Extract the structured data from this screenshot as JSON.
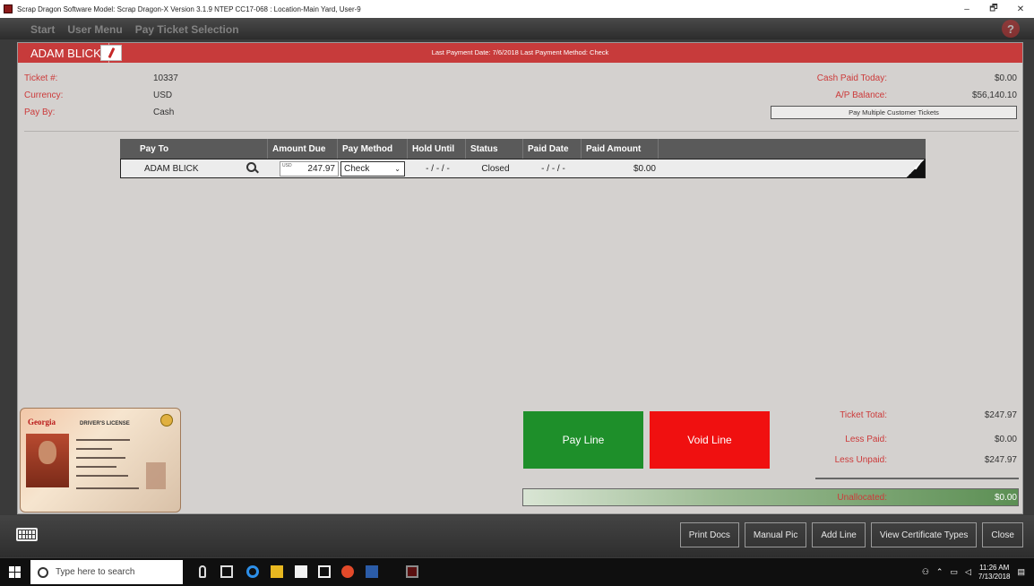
{
  "window": {
    "title": "Scrap Dragon Software Model: Scrap Dragon-X Version 3.1.9 NTEP CC17-068 : Location-Main Yard, User-9",
    "minimize": "–",
    "maximize": "🗗",
    "close": "✕"
  },
  "nav": {
    "start": "Start",
    "user_menu": "User Menu",
    "pay_ticket": "Pay Ticket Selection",
    "help": "?"
  },
  "customer": {
    "name": "ADAM BLICK",
    "payment_info": "Last Payment Date: 7/6/2018   Last Payment Method: Check"
  },
  "ticket": {
    "number_label": "Ticket #:",
    "number": "10337",
    "currency_label": "Currency:",
    "currency": "USD",
    "pay_by_label": "Pay By:",
    "pay_by": "Cash"
  },
  "summary": {
    "cash_paid_label": "Cash Paid Today:",
    "cash_paid": "$0.00",
    "ap_balance_label": "A/P Balance:",
    "ap_balance": "$56,140.10",
    "multi_button": "Pay Multiple Customer Tickets"
  },
  "grid": {
    "headers": [
      "Pay To",
      "Amount Due",
      "Pay Method",
      "Hold Until",
      "Status",
      "Paid Date",
      "Paid Amount"
    ],
    "row": {
      "pay_to": "ADAM BLICK",
      "currency": "USD",
      "amount_due": "247.97",
      "pay_method": "Check",
      "hold_until": "- / - / -",
      "status": "Closed",
      "paid_date": "- / - / -",
      "paid_amount": "$0.00"
    }
  },
  "id_card": {
    "state": "Georgia",
    "type": "DRIVER'S LICENSE"
  },
  "actions": {
    "pay_line": "Pay Line",
    "void_line": "Void Line"
  },
  "totals": {
    "ticket_total_label": "Ticket Total:",
    "ticket_total": "$247.97",
    "less_paid_label": "Less Paid:",
    "less_paid": "$0.00",
    "less_unpaid_label": "Less Unpaid:",
    "less_unpaid": "$247.97",
    "unallocated_label": "Unallocated:",
    "unallocated": "$0.00"
  },
  "footer": {
    "print_docs": "Print Docs",
    "manual_pic": "Manual Pic",
    "add_line": "Add Line",
    "view_cert": "View Certificate Types",
    "close": "Close"
  },
  "taskbar": {
    "search_placeholder": "Type here to search",
    "time": "11:26 AM",
    "date": "7/13/2018"
  },
  "colors": {
    "accent_red": "#c73b3b",
    "pay_green": "#1e8f2a",
    "void_red": "#f01010"
  }
}
